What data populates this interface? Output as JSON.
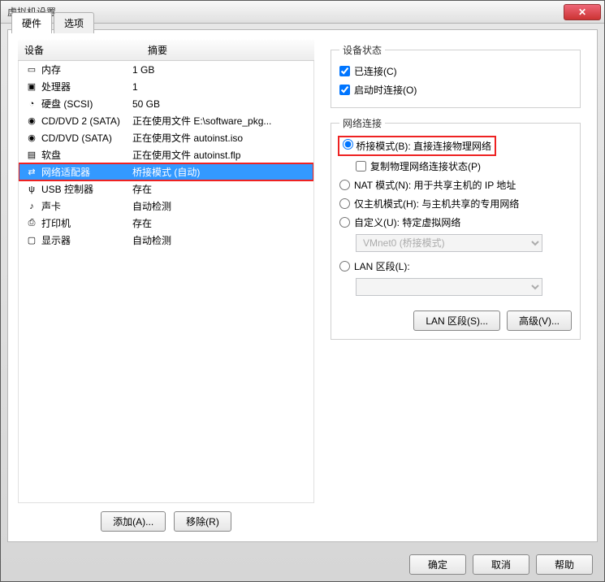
{
  "window": {
    "title": "虚拟机设置"
  },
  "tabs": {
    "hardware": "硬件",
    "options": "选项"
  },
  "table": {
    "header_device": "设备",
    "header_summary": "摘要",
    "rows": [
      {
        "icon": "memory-icon",
        "device": "内存",
        "summary": "1 GB"
      },
      {
        "icon": "cpu-icon",
        "device": "处理器",
        "summary": "1"
      },
      {
        "icon": "disk-icon",
        "device": "硬盘 (SCSI)",
        "summary": "50 GB"
      },
      {
        "icon": "cd-icon",
        "device": "CD/DVD 2 (SATA)",
        "summary": "正在使用文件 E:\\software_pkg..."
      },
      {
        "icon": "cd-icon",
        "device": "CD/DVD (SATA)",
        "summary": "正在使用文件 autoinst.iso"
      },
      {
        "icon": "floppy-icon",
        "device": "软盘",
        "summary": "正在使用文件 autoinst.flp"
      },
      {
        "icon": "network-icon",
        "device": "网络适配器",
        "summary": "桥接模式 (自动)"
      },
      {
        "icon": "usb-icon",
        "device": "USB 控制器",
        "summary": "存在"
      },
      {
        "icon": "sound-icon",
        "device": "声卡",
        "summary": "自动检测"
      },
      {
        "icon": "printer-icon",
        "device": "打印机",
        "summary": "存在"
      },
      {
        "icon": "display-icon",
        "device": "显示器",
        "summary": "自动检测"
      }
    ]
  },
  "buttons": {
    "add": "添加(A)...",
    "remove": "移除(R)",
    "lanSegments": "LAN 区段(S)...",
    "advanced": "高级(V)...",
    "ok": "确定",
    "cancel": "取消",
    "help": "帮助"
  },
  "right": {
    "deviceStatusTitle": "设备状态",
    "connected": "已连接(C)",
    "connectOnPower": "启动时连接(O)",
    "networkConnTitle": "网络连接",
    "bridged": "桥接模式(B): 直接连接物理网络",
    "replicate": "复制物理网络连接状态(P)",
    "nat": "NAT 模式(N): 用于共享主机的 IP 地址",
    "hostonly": "仅主机模式(H): 与主机共享的专用网络",
    "custom": "自定义(U): 特定虚拟网络",
    "customSelect": "VMnet0 (桥接模式)",
    "lanSegment": "LAN 区段(L):"
  }
}
